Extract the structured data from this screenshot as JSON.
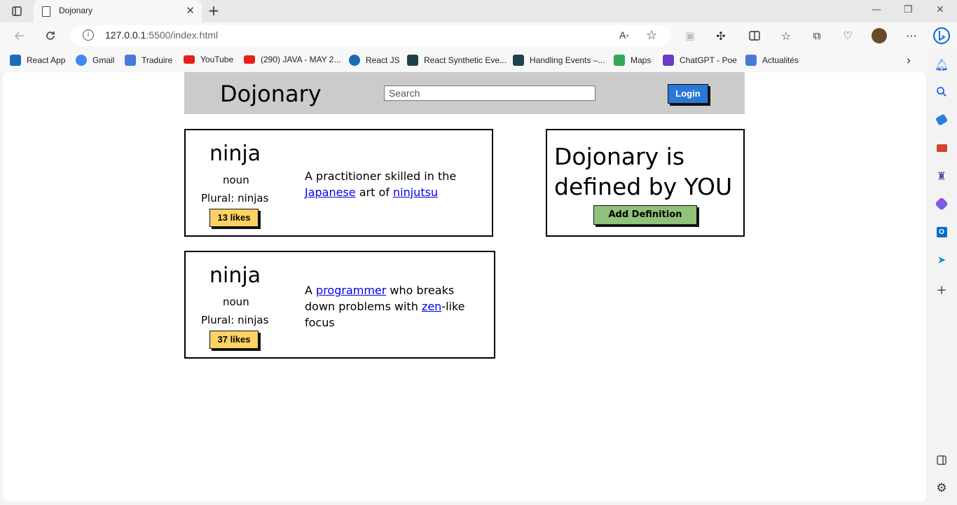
{
  "browser": {
    "tab_title": "Dojonary",
    "url_host": "127.0.0.1",
    "url_rest": ":5500/index.html",
    "bookmarks": [
      {
        "label": "React App",
        "icon": "react-icon",
        "color": "#1a6bb8"
      },
      {
        "label": "Gmail",
        "icon": "google-icon",
        "color": "#4285f4"
      },
      {
        "label": "Traduire",
        "icon": "translate-icon",
        "color": "#4a79d8"
      },
      {
        "label": "YouTube",
        "icon": "youtube-icon",
        "color": "#e62117"
      },
      {
        "label": "(290) JAVA - MAY 2...",
        "icon": "youtube-icon",
        "color": "#e62117"
      },
      {
        "label": "React JS",
        "icon": "react-icon",
        "color": "#1a6bb8"
      },
      {
        "label": "React Synthetic Eve...",
        "icon": "react-icon",
        "color": "#20414a"
      },
      {
        "label": "Handling Events –...",
        "icon": "react-icon",
        "color": "#20414a"
      },
      {
        "label": "Maps",
        "icon": "maps-icon",
        "color": "#34a853"
      },
      {
        "label": "ChatGPT - Poe",
        "icon": "poe-icon",
        "color": "#6b3cc7"
      },
      {
        "label": "Actualités",
        "icon": "news-icon",
        "color": "#4a79d8"
      }
    ]
  },
  "header": {
    "brand": "Dojonary",
    "search_placeholder": "Search",
    "login_label": "Login"
  },
  "definitions": [
    {
      "word": "ninja",
      "part_of_speech": "noun",
      "plural": "Plural: ninjas",
      "likes": "13 likes",
      "def_parts": [
        "A practitioner skilled in the ",
        "Japanese",
        " art of ",
        "ninjutsu"
      ]
    },
    {
      "word": "ninja",
      "part_of_speech": "noun",
      "plural": "Plural: ninjas",
      "likes": "37 likes",
      "def_parts": [
        "A ",
        "programmer",
        " who breaks down problems with ",
        "zen",
        "-like focus"
      ]
    }
  ],
  "promo": {
    "line1": "Dojonary is",
    "line2": "defined by YOU",
    "button_label": "Add Definition"
  },
  "colors": {
    "login": "#2a78d6",
    "likes": "#fdd262",
    "add_definition": "#8fc27a",
    "header": "#cbcbcb",
    "link": "#0000ee"
  }
}
